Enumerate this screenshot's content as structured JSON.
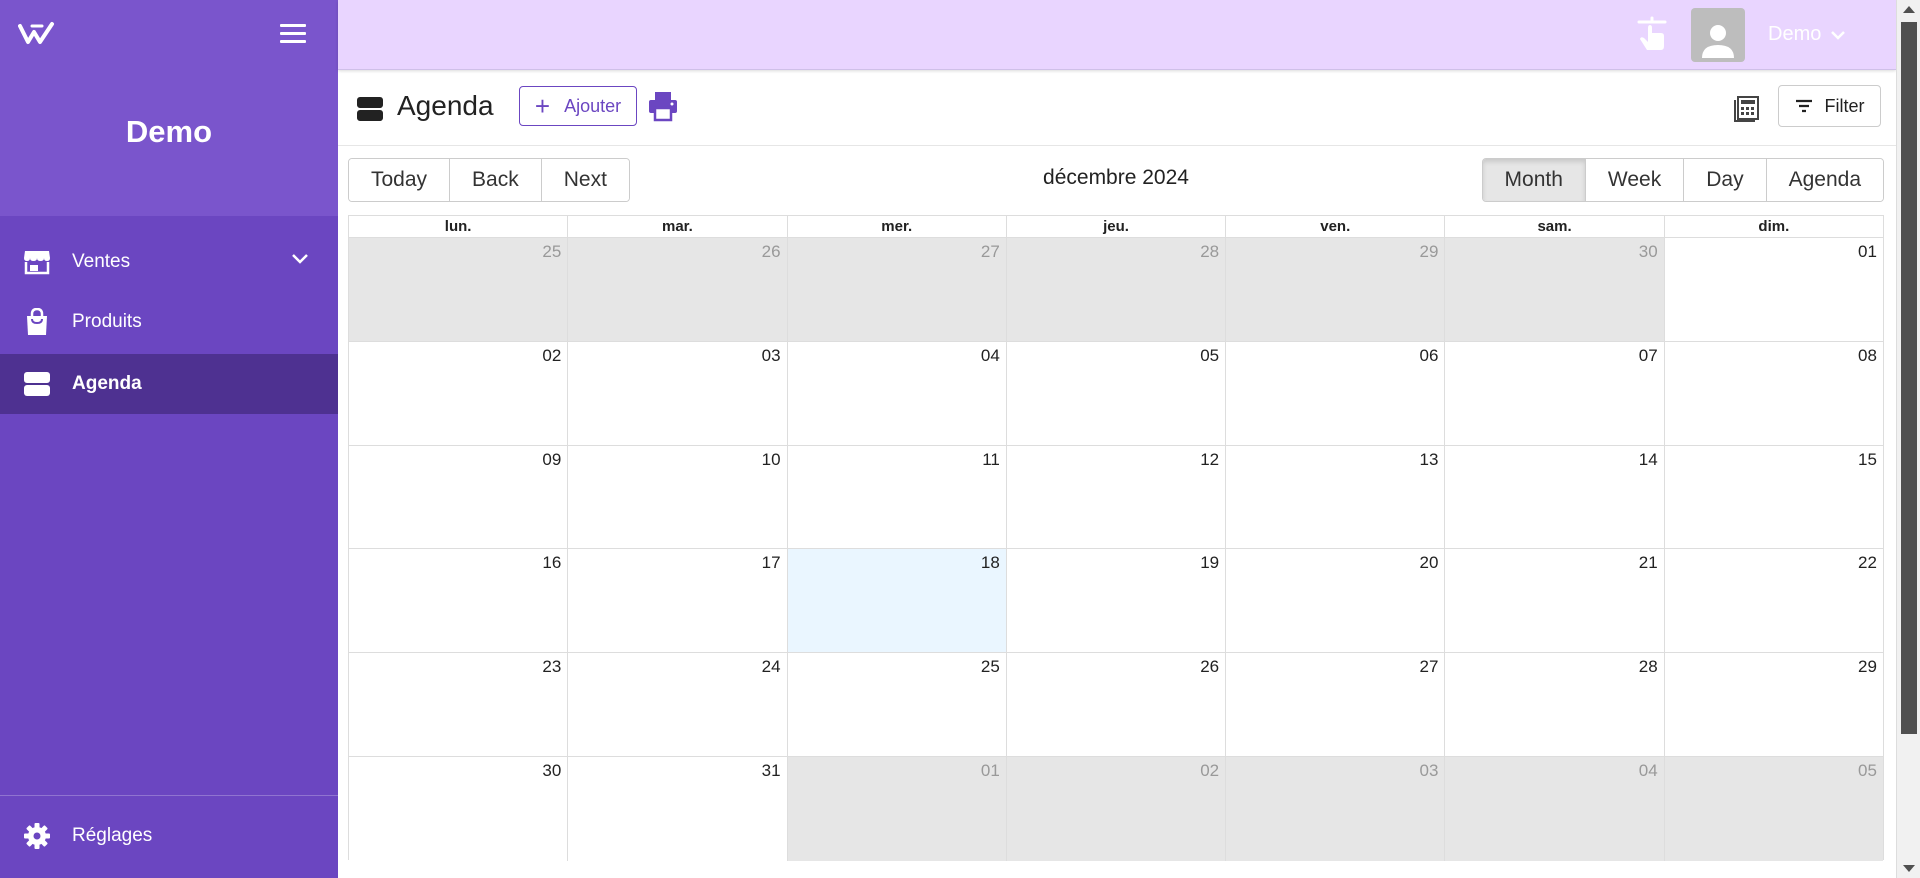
{
  "sidebar": {
    "brand": "Demo",
    "items": [
      {
        "label": "Ventes"
      },
      {
        "label": "Produits"
      },
      {
        "label": "Agenda"
      }
    ],
    "settings_label": "Réglages"
  },
  "topbar": {
    "user_name": "Demo"
  },
  "page": {
    "title": "Agenda",
    "add_label": "Ajouter",
    "filter_label": "Filter"
  },
  "calendar": {
    "nav": [
      "Today",
      "Back",
      "Next"
    ],
    "label": "décembre 2024",
    "views": [
      "Month",
      "Week",
      "Day",
      "Agenda"
    ],
    "active_view": "Month",
    "weekdays": [
      "lun.",
      "mar.",
      "mer.",
      "jeu.",
      "ven.",
      "sam.",
      "dim."
    ],
    "weeks": [
      [
        {
          "d": "25",
          "off": true
        },
        {
          "d": "26",
          "off": true
        },
        {
          "d": "27",
          "off": true
        },
        {
          "d": "28",
          "off": true
        },
        {
          "d": "29",
          "off": true
        },
        {
          "d": "30",
          "off": true
        },
        {
          "d": "01"
        }
      ],
      [
        {
          "d": "02"
        },
        {
          "d": "03"
        },
        {
          "d": "04"
        },
        {
          "d": "05"
        },
        {
          "d": "06"
        },
        {
          "d": "07"
        },
        {
          "d": "08"
        }
      ],
      [
        {
          "d": "09"
        },
        {
          "d": "10"
        },
        {
          "d": "11"
        },
        {
          "d": "12"
        },
        {
          "d": "13"
        },
        {
          "d": "14"
        },
        {
          "d": "15"
        }
      ],
      [
        {
          "d": "16"
        },
        {
          "d": "17"
        },
        {
          "d": "18",
          "today": true
        },
        {
          "d": "19"
        },
        {
          "d": "20"
        },
        {
          "d": "21"
        },
        {
          "d": "22"
        }
      ],
      [
        {
          "d": "23"
        },
        {
          "d": "24"
        },
        {
          "d": "25"
        },
        {
          "d": "26"
        },
        {
          "d": "27"
        },
        {
          "d": "28"
        },
        {
          "d": "29"
        }
      ],
      [
        {
          "d": "30"
        },
        {
          "d": "31"
        },
        {
          "d": "01",
          "off": true
        },
        {
          "d": "02",
          "off": true
        },
        {
          "d": "03",
          "off": true
        },
        {
          "d": "04",
          "off": true
        },
        {
          "d": "05",
          "off": true
        }
      ]
    ]
  },
  "colors": {
    "sidebar": "#6b46c1",
    "sidebar_active": "#4e3191",
    "topbar": "#e9d5ff",
    "accent": "#6b46c1",
    "today": "#eaf6ff",
    "off_range": "#e6e6e6"
  }
}
